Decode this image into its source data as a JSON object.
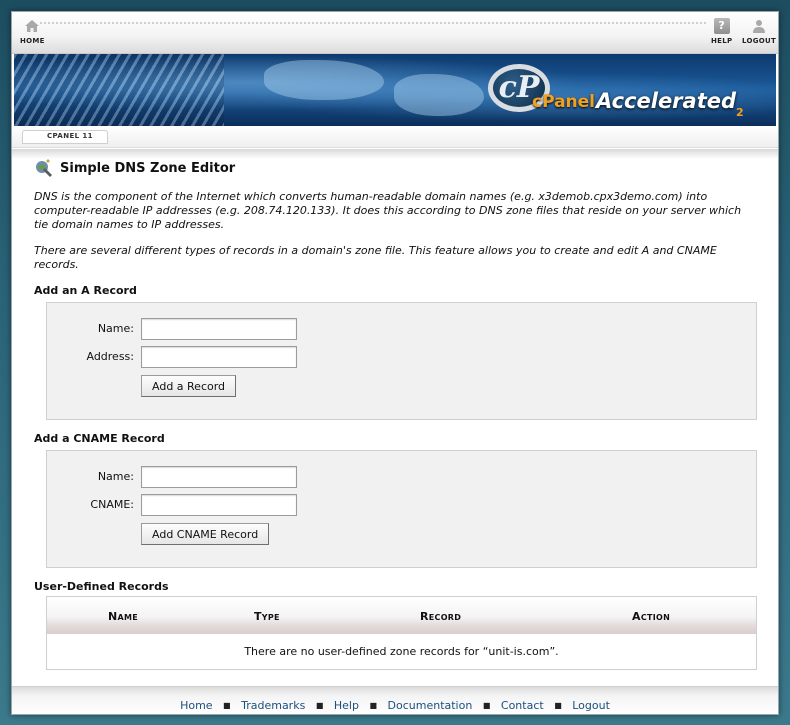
{
  "nav": {
    "home": "HOME",
    "help": "HELP",
    "logout": "LOGOUT"
  },
  "banner": {
    "logo_mark": "cP",
    "brand": "cPanel",
    "product": "Accelerated",
    "version": "2"
  },
  "breadcrumb": "CPANEL 11",
  "page": {
    "title": "Simple DNS Zone Editor",
    "intro_1": "DNS is the component of the Internet which converts human-readable domain names (e.g. x3demob.cpx3demo.com) into computer-readable IP addresses (e.g. 208.74.120.133). It does this according to DNS zone files that reside on your server which tie domain names to IP addresses.",
    "intro_2": "There are several different types of records in a domain's zone file. This feature allows you to create and edit A and CNAME records."
  },
  "a_record": {
    "heading": "Add an A Record",
    "name_label": "Name:",
    "name_value": "",
    "address_label": "Address:",
    "address_value": "",
    "submit_label": "Add a Record"
  },
  "cname_record": {
    "heading": "Add a CNAME Record",
    "name_label": "Name:",
    "name_value": "",
    "cname_label": "CNAME:",
    "cname_value": "",
    "submit_label": "Add CNAME Record"
  },
  "user_records": {
    "heading": "User-Defined Records",
    "columns": [
      "Name",
      "Type",
      "Record",
      "Action"
    ],
    "empty_message": "There are no user-defined zone records for “unit-is.com”."
  },
  "footer": {
    "links": [
      "Home",
      "Trademarks",
      "Help",
      "Documentation",
      "Contact",
      "Logout"
    ],
    "separator": "■"
  },
  "colors": {
    "link": "#1b4f80",
    "brand_orange": "#f2a01d",
    "banner_blue": "#1b5a9a"
  }
}
